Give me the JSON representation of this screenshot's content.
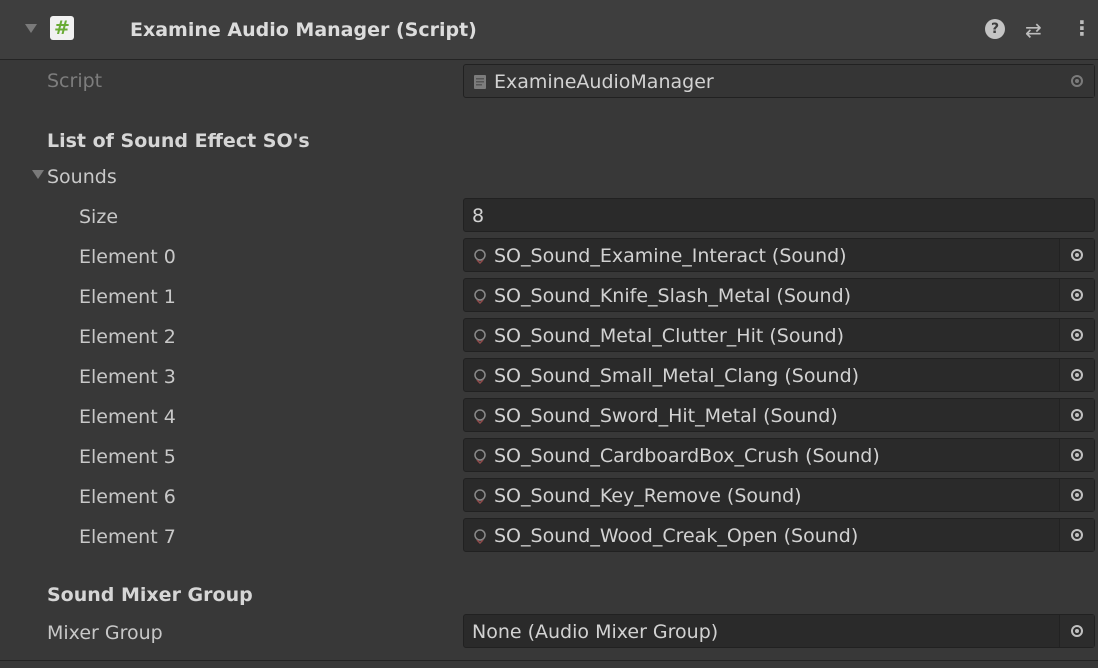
{
  "component": {
    "title": "Examine Audio Manager (Script)",
    "enabled_glyph": "#"
  },
  "script_row": {
    "label": "Script",
    "value": "ExamineAudioManager"
  },
  "section1": {
    "header": "List of Sound Effect SO's"
  },
  "sounds": {
    "label": "Sounds",
    "size_label": "Size",
    "size_value": "8",
    "elements": [
      {
        "label": "Element 0",
        "value": "SO_Sound_Examine_Interact (Sound)"
      },
      {
        "label": "Element 1",
        "value": "SO_Sound_Knife_Slash_Metal (Sound)"
      },
      {
        "label": "Element 2",
        "value": "SO_Sound_Metal_Clutter_Hit (Sound)"
      },
      {
        "label": "Element 3",
        "value": "SO_Sound_Small_Metal_Clang (Sound)"
      },
      {
        "label": "Element 4",
        "value": "SO_Sound_Sword_Hit_Metal (Sound)"
      },
      {
        "label": "Element 5",
        "value": "SO_Sound_CardboardBox_Crush (Sound)"
      },
      {
        "label": "Element 6",
        "value": "SO_Sound_Key_Remove (Sound)"
      },
      {
        "label": "Element 7",
        "value": "SO_Sound_Wood_Creak_Open (Sound)"
      }
    ]
  },
  "section2": {
    "header": "Sound Mixer Group"
  },
  "mixer": {
    "label": "Mixer Group",
    "value": "None (Audio Mixer Group)"
  },
  "icons": {
    "foldout": "triangle-down-icon",
    "help": "help-icon",
    "presets": "presets-icon",
    "menu": "kebab-menu-icon",
    "picker": "object-picker-icon",
    "script": "script-file-icon",
    "sound": "scriptable-object-icon"
  },
  "colors": {
    "background": "#383838",
    "field": "#2a2a2a",
    "header": "#3e3e3e",
    "script_glyph": "#6aab35"
  }
}
